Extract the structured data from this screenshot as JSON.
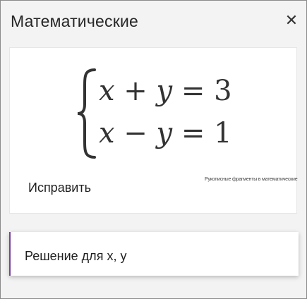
{
  "panel": {
    "title": "Математические",
    "close_icon": "close-icon"
  },
  "equation_card": {
    "equation": {
      "line1": {
        "a": "x",
        "op": " + ",
        "b": "y",
        "rel": " = ",
        "rhs": "3"
      },
      "line2": {
        "a": "x",
        "op": " − ",
        "b": "y",
        "rel": " = ",
        "rhs": "1"
      }
    },
    "fix_label": "Исправить",
    "caption": "Рукописные фрагменты в математические"
  },
  "actions": {
    "solve_label": "Решение для x, y",
    "accent_color": "#7b3fa1"
  }
}
